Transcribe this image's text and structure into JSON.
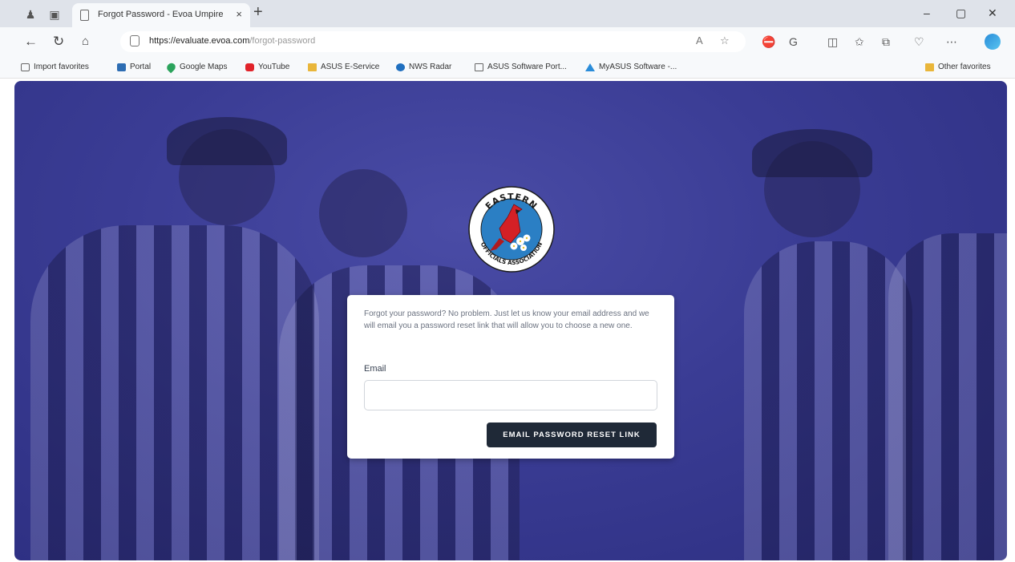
{
  "browser": {
    "tab_title": "Forgot Password - Evoa Umpire",
    "tab_close": "×",
    "new_tab": "+",
    "url_host": "https://evaluate.evoa.com",
    "url_path": "/forgot-password",
    "window_min": "–",
    "window_restore": "▢",
    "window_close": "✕"
  },
  "favorites": {
    "items": [
      {
        "label": "Import favorites",
        "icon": "import-icon"
      },
      {
        "label": "Portal",
        "icon": "portal-icon"
      },
      {
        "label": "Google Maps",
        "icon": "map-pin-icon"
      },
      {
        "label": "YouTube",
        "icon": "youtube-icon"
      },
      {
        "label": "ASUS E-Service",
        "icon": "folder-icon"
      },
      {
        "label": "NWS Radar",
        "icon": "nws-icon"
      },
      {
        "label": "ASUS Software Port...",
        "icon": "page-icon"
      },
      {
        "label": "MyASUS Software -...",
        "icon": "asus-icon"
      }
    ],
    "other": "Other favorites"
  },
  "logo": {
    "top_text": "EASTERN",
    "bottom_text": "OFFICIALS ASSOCIATION",
    "accent": "#d42026",
    "ring": "#2b7fc4"
  },
  "form": {
    "message": "Forgot your password? No problem. Just let us know your email address and we will email you a password reset link that will allow you to choose a new one.",
    "email_label": "Email",
    "email_value": "",
    "submit_label": "EMAIL PASSWORD RESET LINK"
  },
  "colors": {
    "page_bg": "#3a3c94",
    "button_bg": "#1f2937"
  }
}
